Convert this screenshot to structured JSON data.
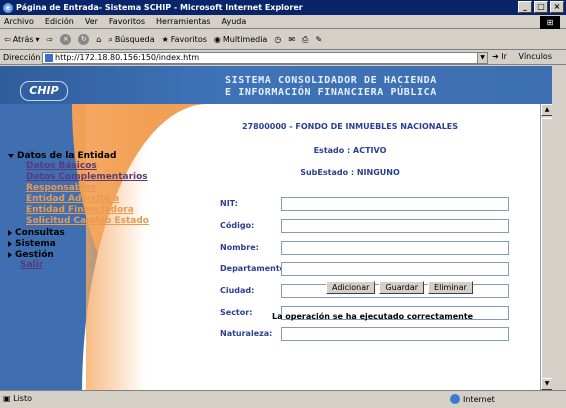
{
  "window": {
    "title": "Página de Entrada- Sistema SCHIP - Microsoft Internet Explorer"
  },
  "menu": [
    "Archivo",
    "Edición",
    "Ver",
    "Favoritos",
    "Herramientas",
    "Ayuda"
  ],
  "toolbar": {
    "back": "Atrás",
    "search": "Búsqueda",
    "favorites": "Favoritos",
    "multimedia": "Multimedia"
  },
  "address": {
    "label": "Dirección",
    "url": "http://172.18.80.156:150/index.htm",
    "go": "Ir",
    "links": "Vínculos"
  },
  "banner": {
    "logo": "CHIP",
    "line1": "SISTEMA CONSOLIDADOR DE HACIENDA",
    "line2": "E INFORMACIÓN FINANCIERA PÚBLICA"
  },
  "nav": {
    "datos_entidad": "Datos de la Entidad",
    "items": [
      "Datos Básicos",
      "Datos Complementarios",
      "Responsables",
      "Entidad Adscrita a",
      "Entidad Financiadora",
      "Solicitud Cambio Estado"
    ],
    "consultas": "Consultas",
    "sistema": "Sistema",
    "gestion": "Gestión",
    "salir": "Salir"
  },
  "entity": {
    "name": "27800000 - FONDO DE INMUEBLES NACIONALES",
    "estado": "Estado : ACTIVO",
    "subestado": "SubEstado : NINGUNO"
  },
  "form": {
    "fields": [
      "NIT:",
      "Código:",
      "Nombre:",
      "Departamento:",
      "Ciudad:",
      "Sector:",
      "Naturaleza:"
    ]
  },
  "buttons": {
    "add": "Adicionar",
    "save": "Guardar",
    "delete": "Eliminar"
  },
  "message": "La operación se ha ejecutado correctamente",
  "status": {
    "left": "Listo",
    "zone": "Internet"
  }
}
